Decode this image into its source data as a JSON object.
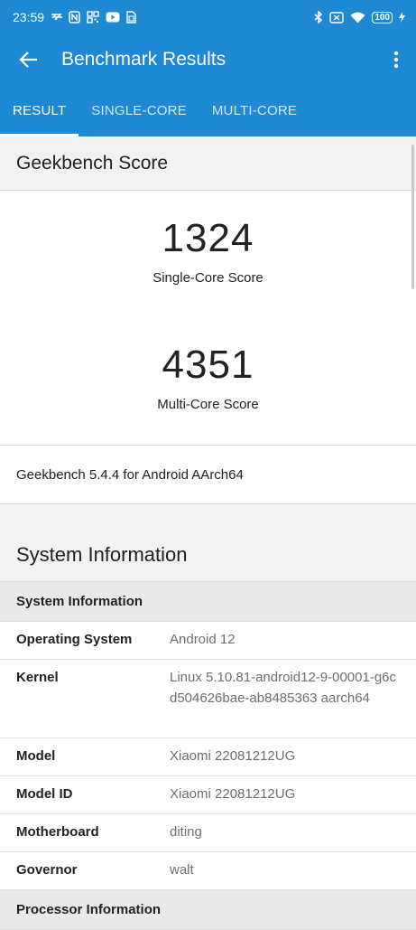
{
  "status_bar": {
    "time": "23:59",
    "battery": "100",
    "icons_left": [
      "signal-s-icon",
      "nfc-icon",
      "qr-icon",
      "youtube-icon",
      "sim-icon"
    ],
    "icons_right": [
      "bluetooth-icon",
      "no-sim-icon",
      "wifi-icon",
      "battery-icon",
      "charging-icon"
    ]
  },
  "app_bar": {
    "title": "Benchmark Results"
  },
  "tabs": [
    {
      "label": "RESULT",
      "active": true
    },
    {
      "label": "SINGLE-CORE",
      "active": false
    },
    {
      "label": "MULTI-CORE",
      "active": false
    }
  ],
  "geekbench": {
    "heading": "Geekbench Score",
    "single_score": "1324",
    "single_label": "Single-Core Score",
    "multi_score": "4351",
    "multi_label": "Multi-Core Score",
    "version": "Geekbench 5.4.4 for Android AArch64"
  },
  "system": {
    "heading": "System Information",
    "subheading": "System Information",
    "rows": [
      {
        "key": "Operating System",
        "value": "Android 12"
      },
      {
        "key": "Kernel",
        "value": "Linux 5.10.81-android12-9-00001-g6cd504626bae-ab8485363 aarch64"
      },
      {
        "key": "Model",
        "value": "Xiaomi 22081212UG"
      },
      {
        "key": "Model ID",
        "value": "Xiaomi 22081212UG"
      },
      {
        "key": "Motherboard",
        "value": "diting"
      },
      {
        "key": "Governor",
        "value": "walt"
      }
    ],
    "processor_heading": "Processor Information"
  },
  "colors": {
    "accent": "#1e88d3"
  }
}
